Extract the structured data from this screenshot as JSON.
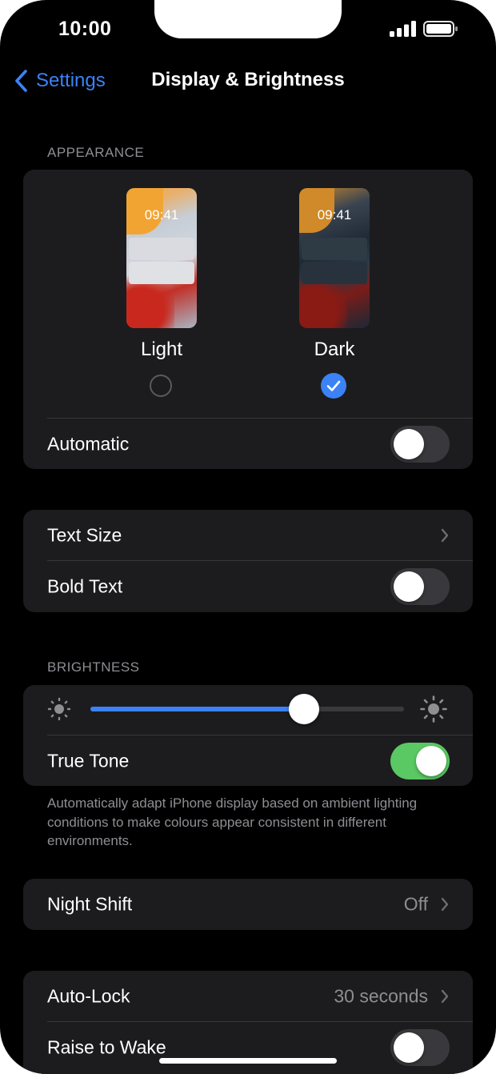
{
  "status_bar": {
    "time": "10:00"
  },
  "nav": {
    "back_label": "Settings",
    "title": "Display & Brightness"
  },
  "appearance": {
    "section_label": "APPEARANCE",
    "options": [
      {
        "label": "Light",
        "preview_time": "09:41",
        "selected": false
      },
      {
        "label": "Dark",
        "preview_time": "09:41",
        "selected": true
      }
    ],
    "automatic": {
      "label": "Automatic",
      "on": false
    }
  },
  "text_group": {
    "text_size": {
      "label": "Text Size"
    },
    "bold_text": {
      "label": "Bold Text",
      "on": false
    }
  },
  "brightness": {
    "section_label": "BRIGHTNESS",
    "level": 0.68,
    "true_tone": {
      "label": "True Tone",
      "on": true
    },
    "footnote": "Automatically adapt iPhone display based on ambient lighting conditions to make colours appear consistent in different environments."
  },
  "night_shift": {
    "label": "Night Shift",
    "value": "Off"
  },
  "lock_group": {
    "auto_lock": {
      "label": "Auto-Lock",
      "value": "30 seconds"
    },
    "raise_to_wake": {
      "label": "Raise to Wake",
      "on": false
    }
  },
  "colors": {
    "accent": "#3b82f6",
    "toggle_on": "#5ac863",
    "card": "#1c1c1e",
    "secondary_text": "#8e8e93"
  }
}
